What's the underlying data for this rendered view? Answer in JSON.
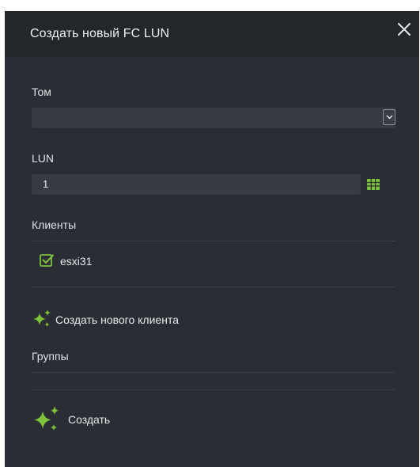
{
  "dialog": {
    "title": "Создать новый FC LUN",
    "close_icon": "close-icon"
  },
  "volume": {
    "label": "Том",
    "value": ""
  },
  "lun": {
    "label": "LUN",
    "value": "1",
    "picker_icon": "grid-icon"
  },
  "clients": {
    "label": "Клиенты",
    "items": [
      {
        "name": "esxi31",
        "checked": true
      }
    ],
    "create_label": "Создать нового клиента"
  },
  "groups": {
    "label": "Группы"
  },
  "submit": {
    "label": "Создать"
  },
  "colors": {
    "accent": "#7ec23b",
    "panel": "#2a2d33",
    "header": "#23262b",
    "input": "#373a41"
  }
}
